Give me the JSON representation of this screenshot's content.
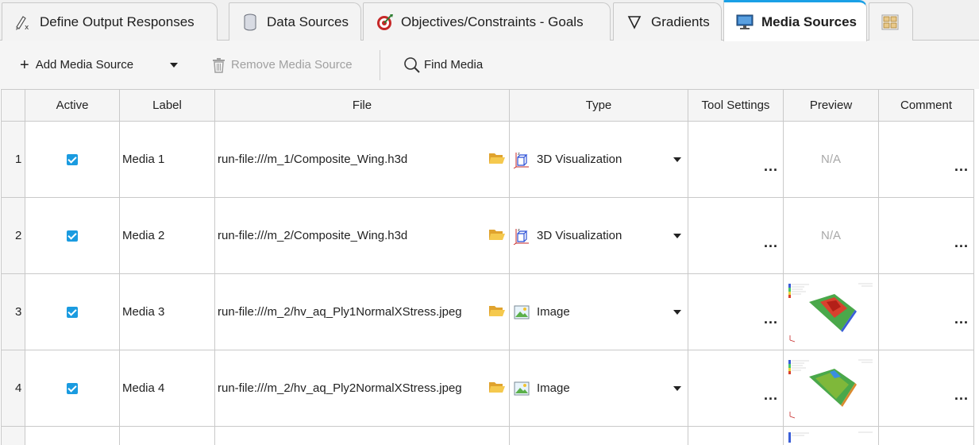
{
  "tabs": [
    {
      "label": "Define Output Responses",
      "icon": "define-outputs-icon",
      "active": false
    },
    {
      "label": "Data Sources",
      "icon": "database-icon",
      "active": false
    },
    {
      "label": "Objectives/Constraints - Goals",
      "icon": "target-icon",
      "active": false
    },
    {
      "label": "Gradients",
      "icon": "nabla-icon",
      "active": false
    },
    {
      "label": "Media Sources",
      "icon": "monitor-icon",
      "active": true
    },
    {
      "label": "",
      "icon": "grid-layout-icon",
      "active": false
    }
  ],
  "toolbar": {
    "add_label": "Add Media Source",
    "add_icon": "plus-icon",
    "remove_label": "Remove Media Source",
    "remove_icon": "trash-icon",
    "find_label": "Find Media",
    "find_icon": "search-icon"
  },
  "columns": [
    "Active",
    "Label",
    "File",
    "Type",
    "Tool Settings",
    "Preview",
    "Comment"
  ],
  "rows": [
    {
      "num": "1",
      "active": true,
      "label": "Media 1",
      "file": "run-file:///m_1/Composite_Wing.h3d",
      "type": "3D Visualization",
      "preview": "N/A"
    },
    {
      "num": "2",
      "active": true,
      "label": "Media 2",
      "file": "run-file:///m_2/Composite_Wing.h3d",
      "type": "3D Visualization",
      "preview": "N/A"
    },
    {
      "num": "3",
      "active": true,
      "label": "Media 3",
      "file": "run-file:///m_2/hv_aq_Ply1NormalXStress.jpeg",
      "type": "Image",
      "preview": ""
    },
    {
      "num": "4",
      "active": true,
      "label": "Media 4",
      "file": "run-file:///m_2/hv_aq_Ply2NormalXStress.jpeg",
      "type": "Image",
      "preview": ""
    }
  ],
  "ellipsis": "...",
  "colors": {
    "accent": "#1aa0e6",
    "checkbox": "#1a9be0"
  }
}
